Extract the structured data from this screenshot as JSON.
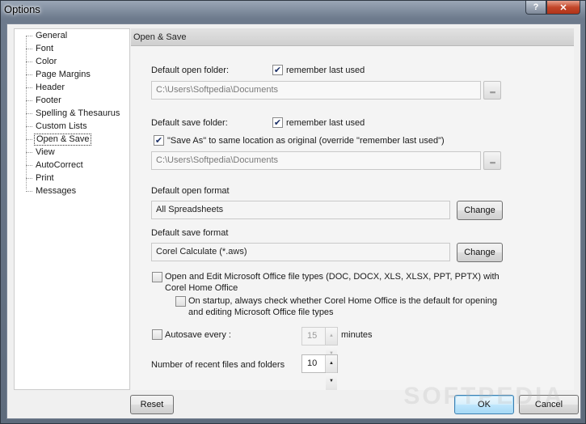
{
  "window": {
    "title": "Options"
  },
  "nav": {
    "items": [
      {
        "label": "General"
      },
      {
        "label": "Font"
      },
      {
        "label": "Color"
      },
      {
        "label": "Page Margins"
      },
      {
        "label": "Header"
      },
      {
        "label": "Footer"
      },
      {
        "label": "Spelling & Thesaurus"
      },
      {
        "label": "Custom Lists"
      },
      {
        "label": "Open & Save",
        "selected": true
      },
      {
        "label": "View"
      },
      {
        "label": "AutoCorrect"
      },
      {
        "label": "Print"
      },
      {
        "label": "Messages"
      }
    ]
  },
  "panel": {
    "header": "Open & Save",
    "open_folder_label": "Default open folder:",
    "open_folder_remember": "remember last used",
    "open_folder_remember_checked": true,
    "open_folder_path": "C:\\Users\\Softpedia\\Documents",
    "save_folder_label": "Default save folder:",
    "save_folder_remember": "remember last used",
    "save_folder_remember_checked": true,
    "save_as_same_location": "\"Save As\" to same location as original (override \"remember last used\")",
    "save_as_same_location_checked": true,
    "save_folder_path": "C:\\Users\\Softpedia\\Documents",
    "open_format_label": "Default open format",
    "open_format_value": "All Spreadsheets",
    "save_format_label": "Default save format",
    "save_format_value": "Corel Calculate (*.aws)",
    "change_label": "Change",
    "ms_office_label_1": "Open and Edit Microsoft Office file types (DOC, DOCX, XLS, XLSX, PPT, PPTX) with",
    "ms_office_label_2": "Corel Home Office",
    "ms_office_checked": false,
    "startup_check_label_1": "On startup, always check whether Corel Home Office is the default for opening",
    "startup_check_label_2": "and editing Microsoft Office file types",
    "startup_check_checked": false,
    "autosave_label": "Autosave every :",
    "autosave_checked": false,
    "autosave_value": "15",
    "autosave_unit": "minutes",
    "recent_label": "Number of recent files and folders",
    "recent_value": "10"
  },
  "footer": {
    "reset": "Reset",
    "ok": "OK",
    "cancel": "Cancel"
  },
  "watermark": "SOFTPEDIA",
  "colors": {
    "accent": "#3c7fb1",
    "close": "#c2462a"
  }
}
